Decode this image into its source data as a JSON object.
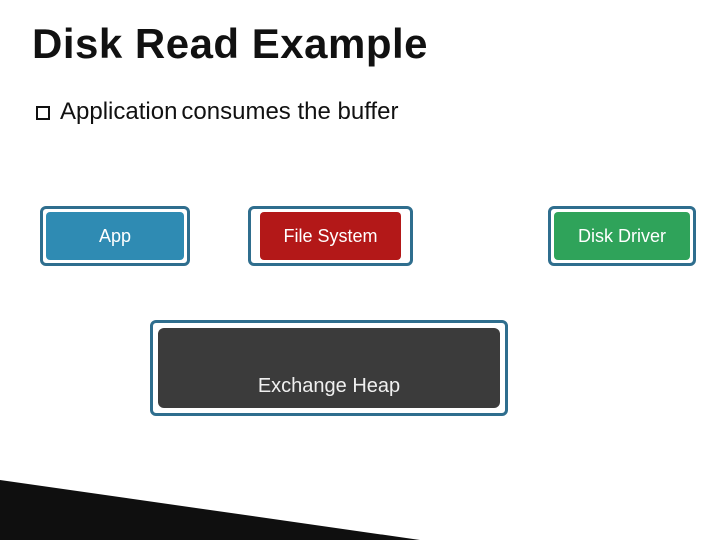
{
  "title": "Disk Read Example",
  "bullet": {
    "lead": "Application",
    "rest": " consumes the buffer"
  },
  "boxes": {
    "app": "App",
    "file_system": "File System",
    "disk_driver": "Disk Driver",
    "exchange_heap": "Exchange Heap"
  },
  "colors": {
    "app_bg": "#2f8bb3",
    "fs_bg": "#b31818",
    "dd_bg": "#2fa35a",
    "ex_bg": "#3b3b3b",
    "border": "#2f6e8e"
  }
}
